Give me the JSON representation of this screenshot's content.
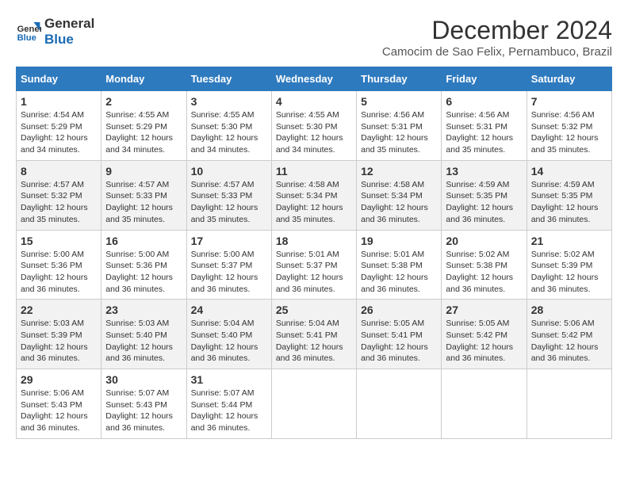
{
  "logo": {
    "line1": "General",
    "line2": "Blue"
  },
  "title": "December 2024",
  "subtitle": "Camocim de Sao Felix, Pernambuco, Brazil",
  "headers": [
    "Sunday",
    "Monday",
    "Tuesday",
    "Wednesday",
    "Thursday",
    "Friday",
    "Saturday"
  ],
  "weeks": [
    [
      {
        "day": "1",
        "sunrise": "Sunrise: 4:54 AM",
        "sunset": "Sunset: 5:29 PM",
        "daylight": "Daylight: 12 hours and 34 minutes."
      },
      {
        "day": "2",
        "sunrise": "Sunrise: 4:55 AM",
        "sunset": "Sunset: 5:29 PM",
        "daylight": "Daylight: 12 hours and 34 minutes."
      },
      {
        "day": "3",
        "sunrise": "Sunrise: 4:55 AM",
        "sunset": "Sunset: 5:30 PM",
        "daylight": "Daylight: 12 hours and 34 minutes."
      },
      {
        "day": "4",
        "sunrise": "Sunrise: 4:55 AM",
        "sunset": "Sunset: 5:30 PM",
        "daylight": "Daylight: 12 hours and 34 minutes."
      },
      {
        "day": "5",
        "sunrise": "Sunrise: 4:56 AM",
        "sunset": "Sunset: 5:31 PM",
        "daylight": "Daylight: 12 hours and 35 minutes."
      },
      {
        "day": "6",
        "sunrise": "Sunrise: 4:56 AM",
        "sunset": "Sunset: 5:31 PM",
        "daylight": "Daylight: 12 hours and 35 minutes."
      },
      {
        "day": "7",
        "sunrise": "Sunrise: 4:56 AM",
        "sunset": "Sunset: 5:32 PM",
        "daylight": "Daylight: 12 hours and 35 minutes."
      }
    ],
    [
      {
        "day": "8",
        "sunrise": "Sunrise: 4:57 AM",
        "sunset": "Sunset: 5:32 PM",
        "daylight": "Daylight: 12 hours and 35 minutes."
      },
      {
        "day": "9",
        "sunrise": "Sunrise: 4:57 AM",
        "sunset": "Sunset: 5:33 PM",
        "daylight": "Daylight: 12 hours and 35 minutes."
      },
      {
        "day": "10",
        "sunrise": "Sunrise: 4:57 AM",
        "sunset": "Sunset: 5:33 PM",
        "daylight": "Daylight: 12 hours and 35 minutes."
      },
      {
        "day": "11",
        "sunrise": "Sunrise: 4:58 AM",
        "sunset": "Sunset: 5:34 PM",
        "daylight": "Daylight: 12 hours and 35 minutes."
      },
      {
        "day": "12",
        "sunrise": "Sunrise: 4:58 AM",
        "sunset": "Sunset: 5:34 PM",
        "daylight": "Daylight: 12 hours and 36 minutes."
      },
      {
        "day": "13",
        "sunrise": "Sunrise: 4:59 AM",
        "sunset": "Sunset: 5:35 PM",
        "daylight": "Daylight: 12 hours and 36 minutes."
      },
      {
        "day": "14",
        "sunrise": "Sunrise: 4:59 AM",
        "sunset": "Sunset: 5:35 PM",
        "daylight": "Daylight: 12 hours and 36 minutes."
      }
    ],
    [
      {
        "day": "15",
        "sunrise": "Sunrise: 5:00 AM",
        "sunset": "Sunset: 5:36 PM",
        "daylight": "Daylight: 12 hours and 36 minutes."
      },
      {
        "day": "16",
        "sunrise": "Sunrise: 5:00 AM",
        "sunset": "Sunset: 5:36 PM",
        "daylight": "Daylight: 12 hours and 36 minutes."
      },
      {
        "day": "17",
        "sunrise": "Sunrise: 5:00 AM",
        "sunset": "Sunset: 5:37 PM",
        "daylight": "Daylight: 12 hours and 36 minutes."
      },
      {
        "day": "18",
        "sunrise": "Sunrise: 5:01 AM",
        "sunset": "Sunset: 5:37 PM",
        "daylight": "Daylight: 12 hours and 36 minutes."
      },
      {
        "day": "19",
        "sunrise": "Sunrise: 5:01 AM",
        "sunset": "Sunset: 5:38 PM",
        "daylight": "Daylight: 12 hours and 36 minutes."
      },
      {
        "day": "20",
        "sunrise": "Sunrise: 5:02 AM",
        "sunset": "Sunset: 5:38 PM",
        "daylight": "Daylight: 12 hours and 36 minutes."
      },
      {
        "day": "21",
        "sunrise": "Sunrise: 5:02 AM",
        "sunset": "Sunset: 5:39 PM",
        "daylight": "Daylight: 12 hours and 36 minutes."
      }
    ],
    [
      {
        "day": "22",
        "sunrise": "Sunrise: 5:03 AM",
        "sunset": "Sunset: 5:39 PM",
        "daylight": "Daylight: 12 hours and 36 minutes."
      },
      {
        "day": "23",
        "sunrise": "Sunrise: 5:03 AM",
        "sunset": "Sunset: 5:40 PM",
        "daylight": "Daylight: 12 hours and 36 minutes."
      },
      {
        "day": "24",
        "sunrise": "Sunrise: 5:04 AM",
        "sunset": "Sunset: 5:40 PM",
        "daylight": "Daylight: 12 hours and 36 minutes."
      },
      {
        "day": "25",
        "sunrise": "Sunrise: 5:04 AM",
        "sunset": "Sunset: 5:41 PM",
        "daylight": "Daylight: 12 hours and 36 minutes."
      },
      {
        "day": "26",
        "sunrise": "Sunrise: 5:05 AM",
        "sunset": "Sunset: 5:41 PM",
        "daylight": "Daylight: 12 hours and 36 minutes."
      },
      {
        "day": "27",
        "sunrise": "Sunrise: 5:05 AM",
        "sunset": "Sunset: 5:42 PM",
        "daylight": "Daylight: 12 hours and 36 minutes."
      },
      {
        "day": "28",
        "sunrise": "Sunrise: 5:06 AM",
        "sunset": "Sunset: 5:42 PM",
        "daylight": "Daylight: 12 hours and 36 minutes."
      }
    ],
    [
      {
        "day": "29",
        "sunrise": "Sunrise: 5:06 AM",
        "sunset": "Sunset: 5:43 PM",
        "daylight": "Daylight: 12 hours and 36 minutes."
      },
      {
        "day": "30",
        "sunrise": "Sunrise: 5:07 AM",
        "sunset": "Sunset: 5:43 PM",
        "daylight": "Daylight: 12 hours and 36 minutes."
      },
      {
        "day": "31",
        "sunrise": "Sunrise: 5:07 AM",
        "sunset": "Sunset: 5:44 PM",
        "daylight": "Daylight: 12 hours and 36 minutes."
      },
      null,
      null,
      null,
      null
    ]
  ]
}
